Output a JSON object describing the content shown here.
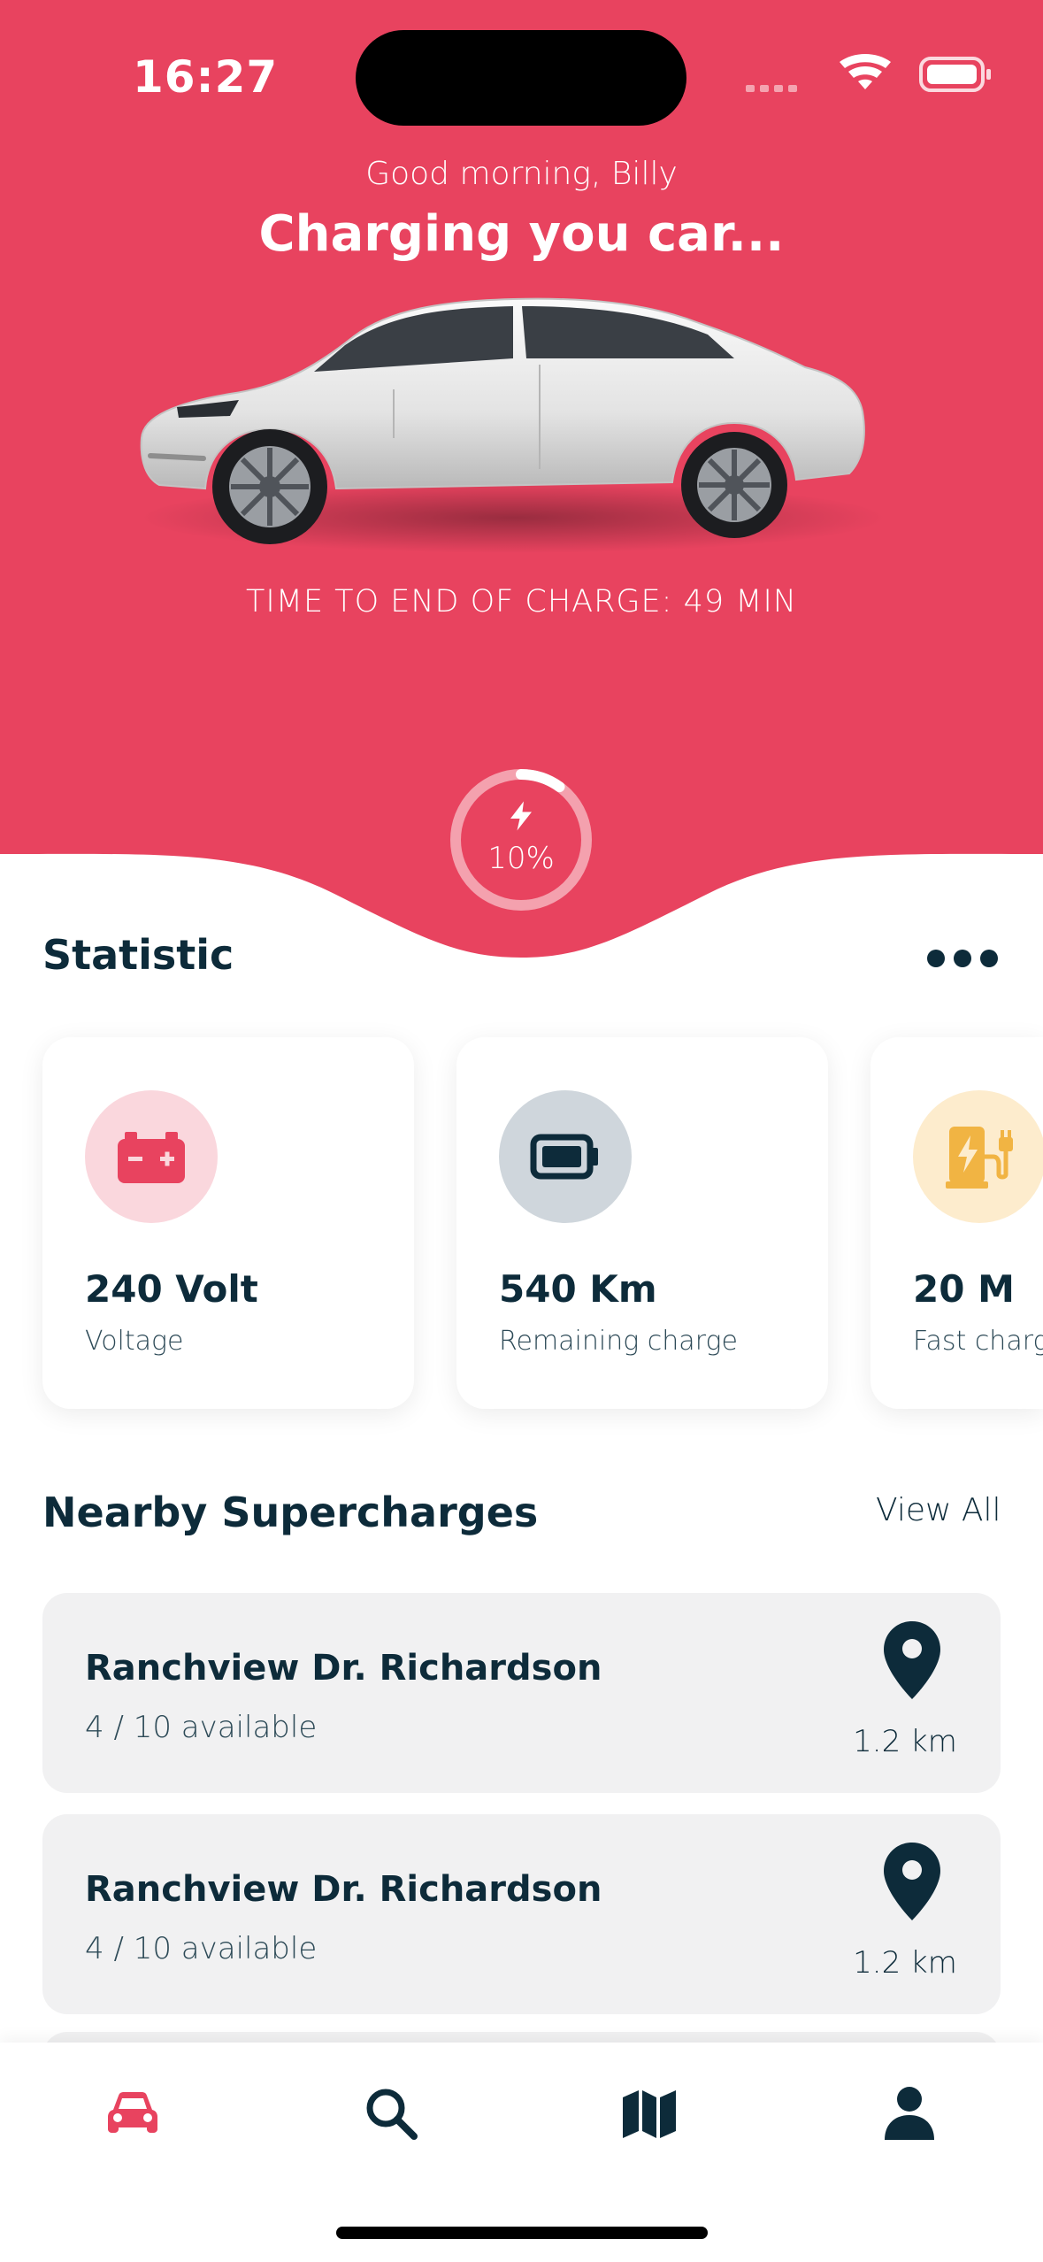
{
  "status_bar": {
    "time": "16:27"
  },
  "header": {
    "greeting": "Good morning, Billy",
    "headline": "Charging you car...",
    "charge_time": "TIME TO END OF CHARGE: 49 MIN",
    "charge_level_text": "10%",
    "charge_level": 0.1
  },
  "colors": {
    "accent": "#e8435f",
    "dark": "#0d2b3a",
    "card_bg": "#f1f1f2"
  },
  "statistic": {
    "title": "Statistic",
    "cards": [
      {
        "value": "240 Volt",
        "label": "Voltage",
        "icon": "car-battery-icon",
        "icon_bg": "#fad7dd",
        "icon_color": "#e8435f"
      },
      {
        "value": "540 Km",
        "label": "Remaining charge",
        "icon": "battery-icon",
        "icon_bg": "#cfd6dc",
        "icon_color": "#0d2b3a"
      },
      {
        "value": "20 M",
        "label": "Fast charg",
        "icon": "charging-station-icon",
        "icon_bg": "#fdeccd",
        "icon_color": "#f1b443"
      }
    ]
  },
  "nearby": {
    "title": "Nearby Supercharges",
    "view_all": "View All",
    "stations": [
      {
        "name": "Ranchview Dr. Richardson",
        "available": "4 / 10 available",
        "distance": "1.2 km"
      },
      {
        "name": "Ranchview Dr. Richardson",
        "available": "4 / 10 available",
        "distance": "1.2 km"
      }
    ]
  },
  "tabbar": {
    "tabs": [
      {
        "icon": "car-icon",
        "active": true
      },
      {
        "icon": "search-icon",
        "active": false
      },
      {
        "icon": "map-icon",
        "active": false
      },
      {
        "icon": "user-icon",
        "active": false
      }
    ]
  }
}
